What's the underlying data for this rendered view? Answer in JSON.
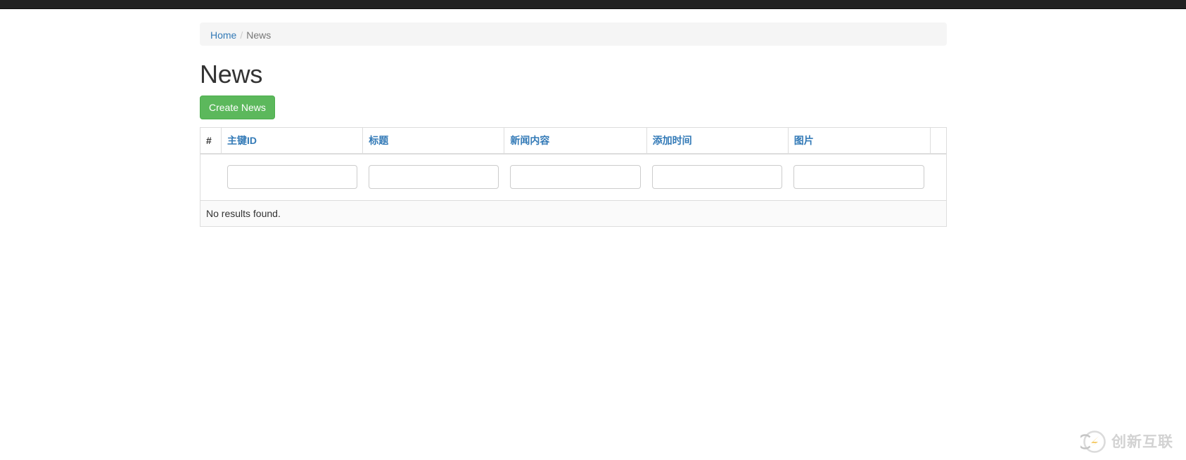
{
  "navbar": {
    "color": "#222222"
  },
  "breadcrumb": {
    "home_label": "Home",
    "separator": "/",
    "current_label": "News"
  },
  "page": {
    "title": "News"
  },
  "toolbar": {
    "create_label": "Create News",
    "create_color": "#5cb85c"
  },
  "grid": {
    "columns": [
      {
        "key": "num",
        "label": "#",
        "sortable": false
      },
      {
        "key": "id",
        "label": "主键ID",
        "sortable": true
      },
      {
        "key": "title",
        "label": "标题",
        "sortable": true
      },
      {
        "key": "content",
        "label": "新闻内容",
        "sortable": true
      },
      {
        "key": "addtime",
        "label": "添加时间",
        "sortable": true
      },
      {
        "key": "image",
        "label": "图片",
        "sortable": true
      },
      {
        "key": "actions",
        "label": "",
        "sortable": false
      }
    ],
    "filters": [
      {
        "key": "num",
        "type": "none",
        "value": "",
        "placeholder": ""
      },
      {
        "key": "id",
        "type": "text",
        "value": "",
        "placeholder": ""
      },
      {
        "key": "title",
        "type": "text",
        "value": "",
        "placeholder": ""
      },
      {
        "key": "content",
        "type": "text",
        "value": "",
        "placeholder": ""
      },
      {
        "key": "addtime",
        "type": "text",
        "value": "",
        "placeholder": ""
      },
      {
        "key": "image",
        "type": "text",
        "value": "",
        "placeholder": ""
      },
      {
        "key": "actions",
        "type": "none",
        "value": "",
        "placeholder": ""
      }
    ],
    "rows": [],
    "empty_text": "No results found.",
    "link_color": "#337ab7"
  },
  "watermark": {
    "text": "创新互联"
  }
}
